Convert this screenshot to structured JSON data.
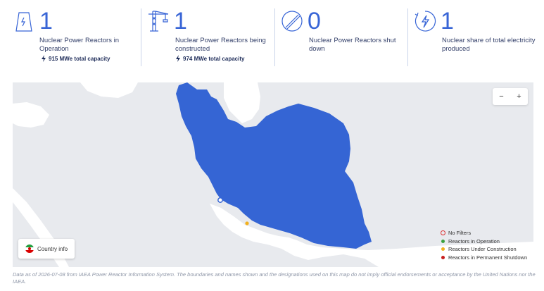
{
  "stats": [
    {
      "value": "1",
      "label": "Nuclear Power Reactors in Operation",
      "capacity": "915 MWe total capacity",
      "icon": "cooling-tower-icon"
    },
    {
      "value": "1",
      "label": "Nuclear Power Reactors being constructed",
      "capacity": "974 MWe total capacity",
      "icon": "crane-icon"
    },
    {
      "value": "0",
      "label": "Nuclear Power Reactors shut down",
      "icon": "shutdown-icon"
    },
    {
      "value": "1",
      "label": "Nuclear share of total electricity produced",
      "icon": "electricity-share-icon"
    }
  ],
  "map": {
    "zoom_out": "−",
    "zoom_in": "+",
    "country_info": "Country info",
    "legend": [
      {
        "label": "No Filters",
        "color": "#d9342b"
      },
      {
        "label": "Reactors in Operation",
        "color": "#3aa040"
      },
      {
        "label": "Reactors Under Construction",
        "color": "#f2b01e"
      },
      {
        "label": "Reactors in Permanent Shutdown",
        "color": "#c81d1d"
      }
    ],
    "country_color": "#3565d4",
    "water_color": "#ffffff",
    "land_color": "#e8eaee"
  },
  "footnote": "Data as of 2026-07-08 from IAEA Power Reactor Information System. The boundaries and names shown and the designations used on this map do not imply official endorsements or acceptance by the United Nations nor the IAEA."
}
